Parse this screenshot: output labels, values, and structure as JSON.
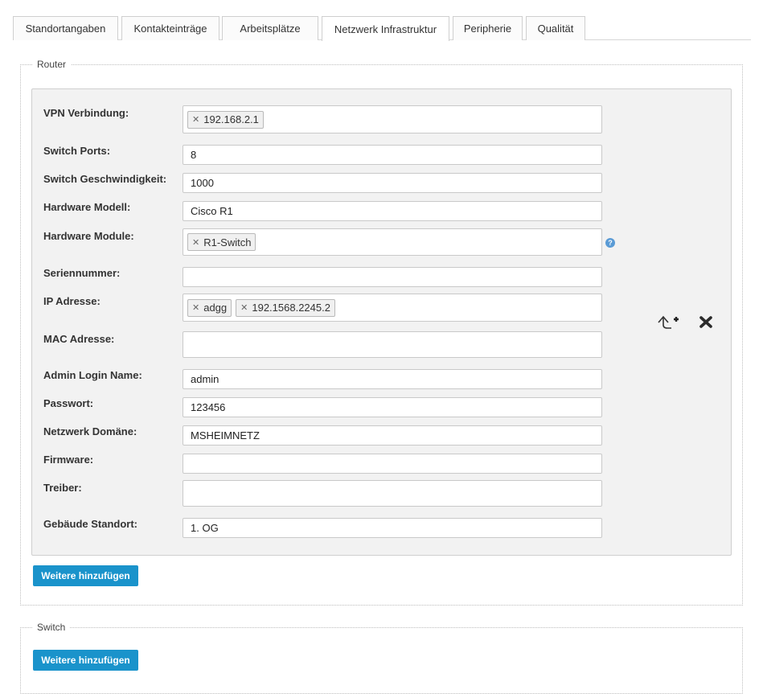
{
  "tabs": [
    {
      "label": "Standortangaben"
    },
    {
      "label": "Kontakteinträge"
    },
    {
      "label": "Arbeitsplätze"
    },
    {
      "label": "Netzwerk Infrastruktur"
    },
    {
      "label": "Peripherie"
    },
    {
      "label": "Qualität"
    }
  ],
  "active_tab": "Netzwerk Infrastruktur",
  "router": {
    "legend": "Router",
    "fields": {
      "vpn": {
        "label": "VPN Verbindung:",
        "tags": [
          "192.168.2.1"
        ]
      },
      "switch_ports": {
        "label": "Switch Ports:",
        "value": "8"
      },
      "switch_speed": {
        "label": "Switch Geschwindigkeit:",
        "value": "1000"
      },
      "hw_model": {
        "label": "Hardware Modell:",
        "value": "Cisco R1"
      },
      "hw_modules": {
        "label": "Hardware Module:",
        "tags": [
          "R1-Switch"
        ]
      },
      "serial": {
        "label": "Seriennummer:",
        "value": ""
      },
      "ip": {
        "label": "IP Adresse:",
        "tags": [
          "adgg",
          "192.1568.2245.2"
        ]
      },
      "mac": {
        "label": "MAC Adresse:",
        "value": ""
      },
      "admin_login": {
        "label": "Admin Login Name:",
        "value": "admin"
      },
      "password": {
        "label": "Passwort:",
        "value": "123456"
      },
      "domain": {
        "label": "Netzwerk Domäne:",
        "value": "MSHEIMNETZ"
      },
      "firmware": {
        "label": "Firmware:",
        "value": ""
      },
      "driver": {
        "label": "Treiber:",
        "value": ""
      },
      "location": {
        "label": "Gebäude Standort:",
        "value": "1. OG"
      }
    },
    "add_button": "Weitere hinzufügen"
  },
  "switch": {
    "legend": "Switch",
    "add_button": "Weitere hinzufügen"
  },
  "icons": {
    "help": "help-icon",
    "duplicate": "duplicate-add-icon",
    "delete": "delete-x-icon"
  },
  "colors": {
    "primary_button": "#1a93cb",
    "panel_bg": "#f2f2f2",
    "help_icon": "#5a9bd5"
  }
}
